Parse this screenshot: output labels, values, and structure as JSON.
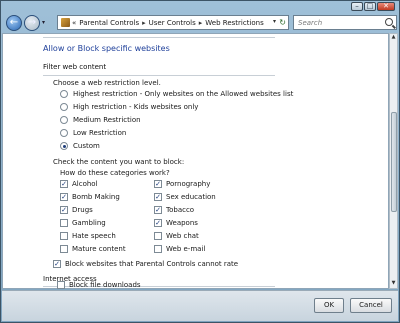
{
  "window": {
    "minimize": "–",
    "maximize": "□",
    "close": "✕"
  },
  "nav": {
    "back": "←",
    "forward": "→",
    "crumb_prefix": "«",
    "breadcrumb": [
      "Parental Controls",
      "User Controls",
      "Web Restrictions"
    ],
    "search_placeholder": "Search"
  },
  "page": {
    "title": "Allow or Block specific websites",
    "filter_heading": "Filter web content",
    "choose_level": "Choose a web restriction level.",
    "levels": [
      {
        "label": "Highest restriction - Only websites on the Allowed websites list",
        "selected": false
      },
      {
        "label": "High restriction - Kids websites only",
        "selected": false
      },
      {
        "label": "Medium Restriction",
        "selected": false
      },
      {
        "label": "Low Restriction",
        "selected": false
      },
      {
        "label": "Custom",
        "selected": true
      }
    ],
    "check_content": "Check the content you want to block:",
    "how_link": "How do these categories work?",
    "categories_left": [
      {
        "label": "Alcohol",
        "checked": true
      },
      {
        "label": "Bomb Making",
        "checked": true
      },
      {
        "label": "Drugs",
        "checked": true
      },
      {
        "label": "Gambling",
        "checked": false
      },
      {
        "label": "Hate speech",
        "checked": false
      },
      {
        "label": "Mature content",
        "checked": false
      }
    ],
    "categories_right": [
      {
        "label": "Pornography",
        "checked": true
      },
      {
        "label": "Sex education",
        "checked": true
      },
      {
        "label": "Tobacco",
        "checked": true
      },
      {
        "label": "Weapons",
        "checked": true
      },
      {
        "label": "Web chat",
        "checked": false
      },
      {
        "label": "Web e-mail",
        "checked": false
      }
    ],
    "block_unrated": {
      "label": "Block websites that Parental Controls cannot rate",
      "checked": true
    },
    "internet_access": "Internet access",
    "block_downloads": {
      "label": "Block file downloads",
      "checked": false
    }
  },
  "footer": {
    "ok": "OK",
    "cancel": "Cancel"
  },
  "colors": {
    "link": "#1e3f9a",
    "frame": "#9fc0d8"
  }
}
